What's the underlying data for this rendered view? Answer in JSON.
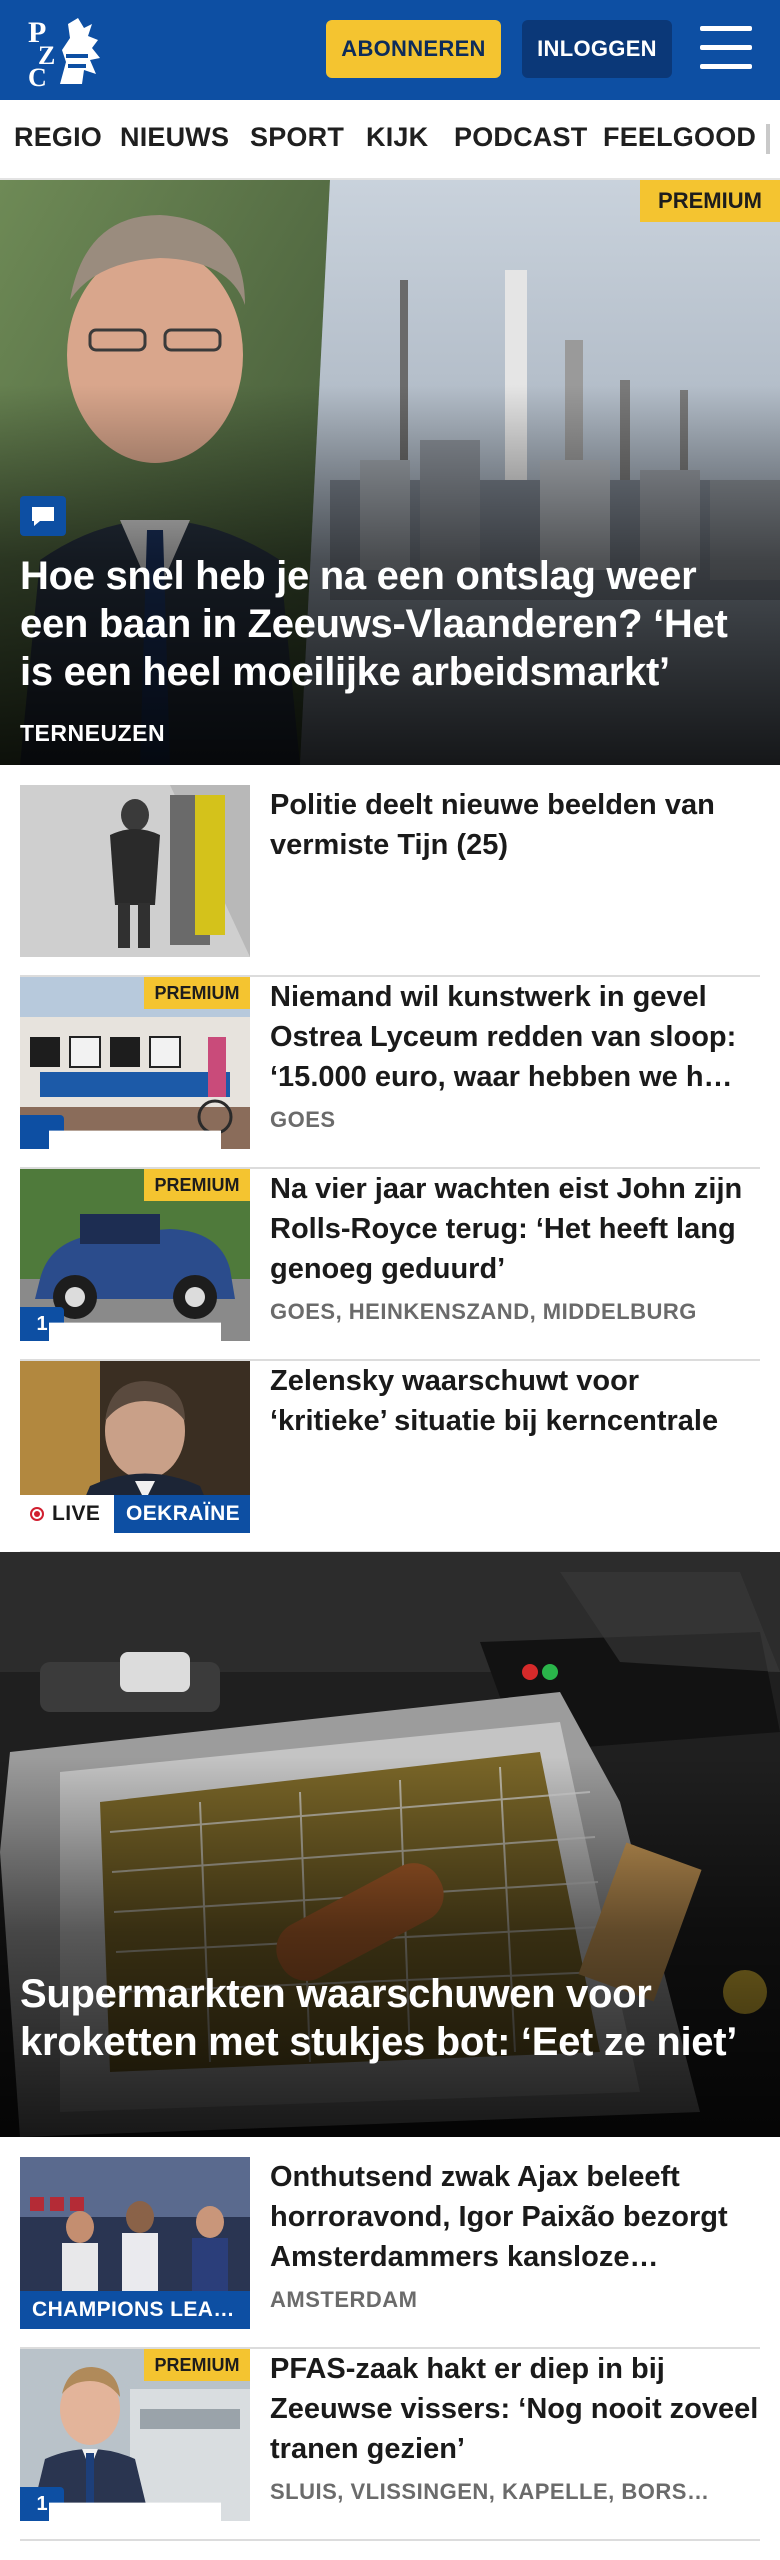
{
  "header": {
    "logo_text": "PZC",
    "subscribe_label": "ABONNEREN",
    "login_label": "INLOGGEN",
    "menu_icon": "hamburger-menu-icon"
  },
  "nav": {
    "items": [
      "REGIO",
      "NIEUWS",
      "SPORT",
      "KIJK",
      "PODCAST",
      "FEELGOOD"
    ]
  },
  "hero1": {
    "premium": "PREMIUM",
    "title": "Hoe snel heb je na een ontslag weer een baan in Zeeuws-Vlaanderen? ‘Het is een heel moeilijke arbeidsmarkt’",
    "location": "TERNEUZEN",
    "icon": "comment-icon"
  },
  "articles": [
    {
      "title": "Politie deelt nieuwe beelden van vermiste Tijn (25)",
      "location": ""
    },
    {
      "premium": "PREMIUM",
      "title": "Niemand wil kunstwerk in gevel Ostrea Lyceum redden van sloop: ‘15.000 euro, waar hebben we h…",
      "location": "GOES",
      "icon": "comment-icon"
    },
    {
      "premium": "PREMIUM",
      "title": "Na vier jaar wachten eist John zijn Rolls-Royce terug: ‘Het heeft lang genoeg geduurd’",
      "location": "GOES, HEINKENSZAND, MIDDELBURG",
      "comments": "1",
      "icon": "comment-icon"
    },
    {
      "title": "Zelensky waarschuwt voor ‘kritieke’ situatie bij kerncentra­le",
      "live": "LIVE",
      "category": "OEKRAÏNE"
    }
  ],
  "hero2": {
    "title": "Supermarkten waarschuwen voor kroketten met stukjes bot: ‘Eet ze niet’"
  },
  "articles2": [
    {
      "title": "Onthutsend zwak Ajax beleeft horroravond, Igor Paixão bezorgt Amsterdammers kansloze…",
      "location": "AMSTERDAM",
      "category": "CHAMPIONS LEA…"
    },
    {
      "premium": "PREMIUM",
      "title": "PFAS-zaak hakt er diep in bij Zeeuwse vissers: ‘Nog nooit zoveel tranen gezien’",
      "location": "SLUIS, VLISSINGEN, KAPELLE, BORS…",
      "comments": "1",
      "icon": "comment-icon"
    }
  ],
  "colors": {
    "brand_blue": "#0d4fa3",
    "premium_yellow": "#f4c430",
    "live_red": "#d11f2f"
  }
}
